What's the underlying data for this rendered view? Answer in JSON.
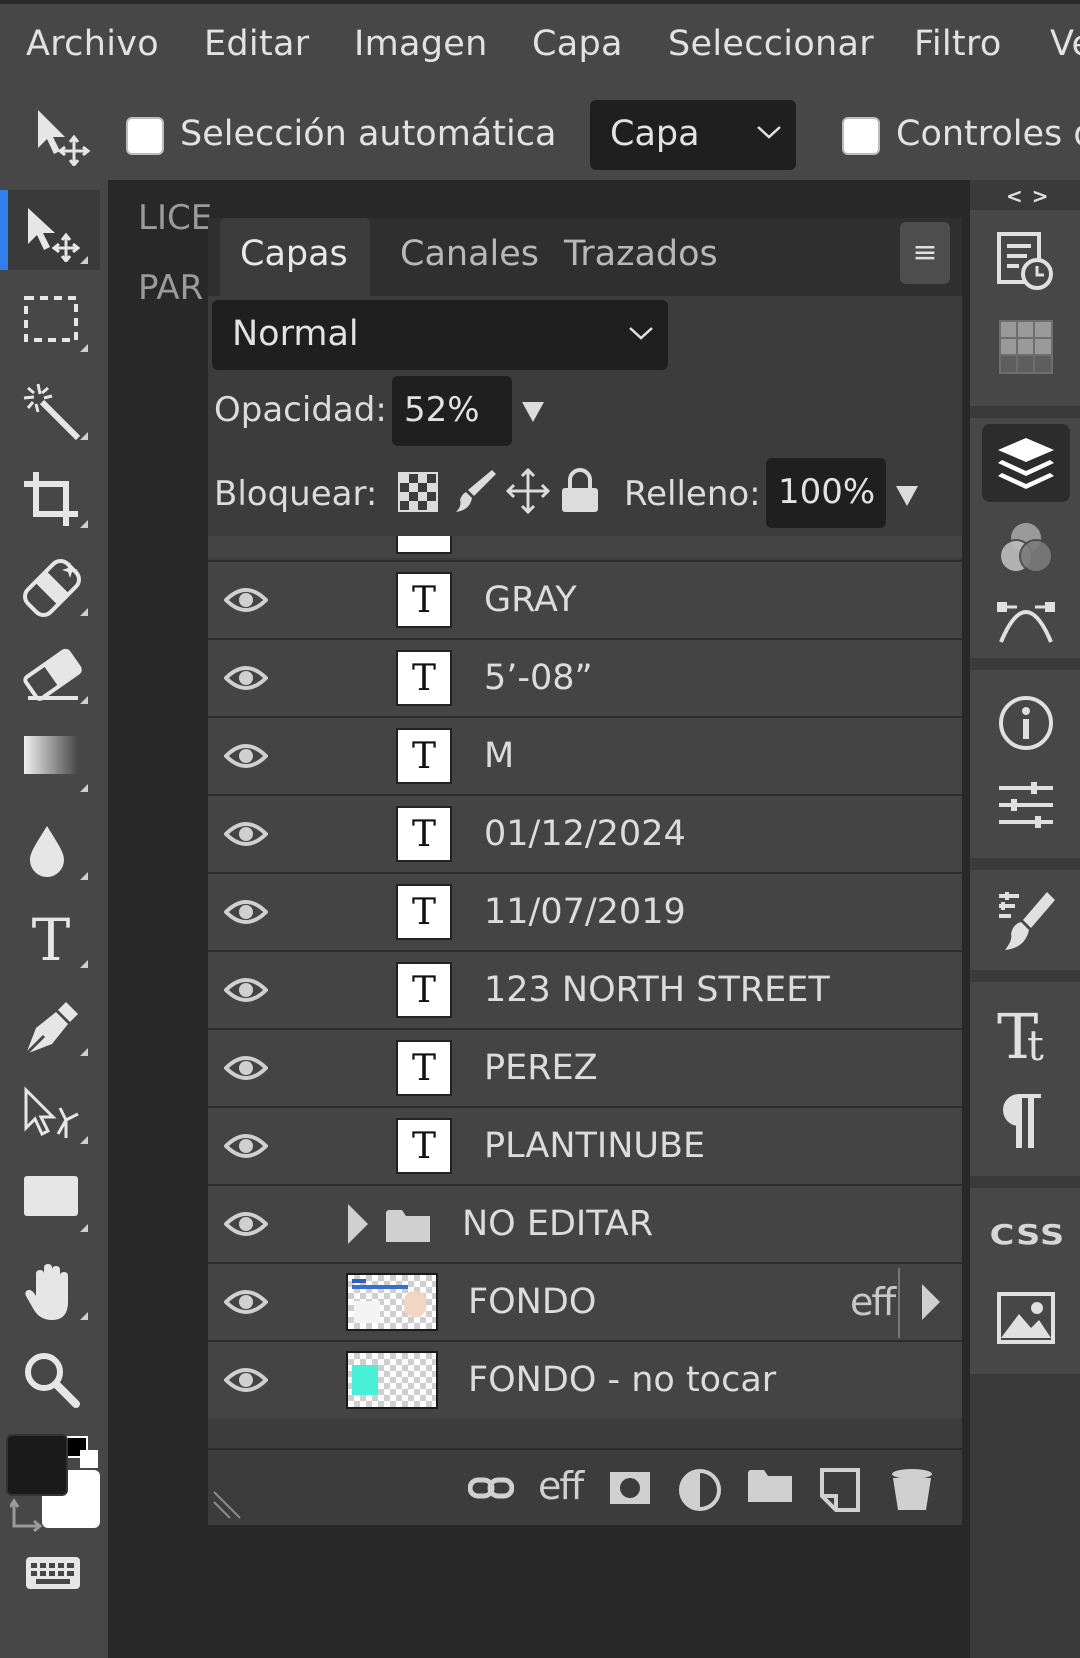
{
  "menu": {
    "items": [
      "Archivo",
      "Editar",
      "Imagen",
      "Capa",
      "Seleccionar",
      "Filtro",
      "Ve"
    ]
  },
  "options": {
    "auto_select_label": "Selección automática",
    "auto_select_target": "Capa",
    "controls_label": "Controles d"
  },
  "workspace": {
    "doc_text_1": "LICE",
    "doc_text_2": "PAR"
  },
  "panel": {
    "tabs": [
      {
        "label": "Capas",
        "active": true
      },
      {
        "label": "Canales",
        "active": false
      },
      {
        "label": "Trazados",
        "active": false
      }
    ],
    "menu_glyph": "≡",
    "blend_mode": "Normal",
    "opacity_label": "Opacidad:",
    "opacity_value": "52%",
    "lock_label": "Bloquear:",
    "fill_label": "Relleno:",
    "fill_value": "100%",
    "text_layer_glyph": "T",
    "layers": [
      {
        "name": "GRAY",
        "type": "text"
      },
      {
        "name": "5’-08”",
        "type": "text"
      },
      {
        "name": "M",
        "type": "text"
      },
      {
        "name": "01/12/2024",
        "type": "text"
      },
      {
        "name": "11/07/2019",
        "type": "text"
      },
      {
        "name": "123 NORTH STREET",
        "type": "text"
      },
      {
        "name": "PEREZ",
        "type": "text"
      },
      {
        "name": "PLANTINUBE",
        "type": "text"
      },
      {
        "name": "NO EDITAR",
        "type": "folder"
      },
      {
        "name": "FONDO",
        "type": "image",
        "fx": "eff"
      },
      {
        "name": "FONDO - no tocar",
        "type": "image"
      }
    ],
    "footer_fx": "eff"
  },
  "rightbar": {
    "collapse_glyph": "< >",
    "css_label": "CSS"
  },
  "colors": {
    "accent": "#2f7fef",
    "foreground": "#1a1a1a",
    "background": "#ffffff",
    "swatch_cyan": "#48f0d8"
  }
}
